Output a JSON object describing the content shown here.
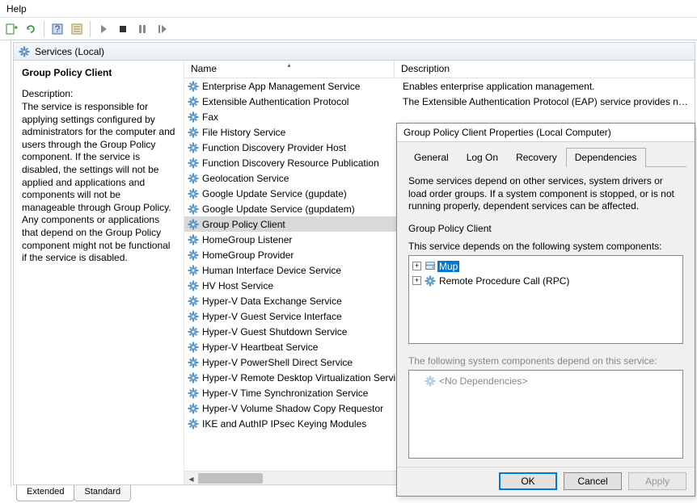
{
  "menu": {
    "help": "Help"
  },
  "header": {
    "title": "Services (Local)"
  },
  "desc_pane": {
    "title": "Group Policy Client",
    "label": "Description:",
    "text": "The service is responsible for applying settings configured by administrators for the computer and users through the Group Policy component. If the service is disabled, the settings will not be applied and applications and components will not be manageable through Group Policy. Any components or applications that depend on the Group Policy component might not be functional if the service is disabled."
  },
  "columns": {
    "name": "Name",
    "description": "Description"
  },
  "services": [
    {
      "name": "Enterprise App Management Service",
      "desc": "Enables enterprise application management."
    },
    {
      "name": "Extensible Authentication Protocol",
      "desc": "The Extensible Authentication Protocol (EAP) service provides n…"
    },
    {
      "name": "Fax",
      "desc": ""
    },
    {
      "name": "File History Service",
      "desc": ""
    },
    {
      "name": "Function Discovery Provider Host",
      "desc": ""
    },
    {
      "name": "Function Discovery Resource Publication",
      "desc": ""
    },
    {
      "name": "Geolocation Service",
      "desc": ""
    },
    {
      "name": "Google Update Service (gupdate)",
      "desc": ""
    },
    {
      "name": "Google Update Service (gupdatem)",
      "desc": ""
    },
    {
      "name": "Group Policy Client",
      "desc": "",
      "selected": true
    },
    {
      "name": "HomeGroup Listener",
      "desc": ""
    },
    {
      "name": "HomeGroup Provider",
      "desc": ""
    },
    {
      "name": "Human Interface Device Service",
      "desc": ""
    },
    {
      "name": "HV Host Service",
      "desc": ""
    },
    {
      "name": "Hyper-V Data Exchange Service",
      "desc": ""
    },
    {
      "name": "Hyper-V Guest Service Interface",
      "desc": ""
    },
    {
      "name": "Hyper-V Guest Shutdown Service",
      "desc": ""
    },
    {
      "name": "Hyper-V Heartbeat Service",
      "desc": ""
    },
    {
      "name": "Hyper-V PowerShell Direct Service",
      "desc": ""
    },
    {
      "name": "Hyper-V Remote Desktop Virtualization Servi",
      "desc": ""
    },
    {
      "name": "Hyper-V Time Synchronization Service",
      "desc": ""
    },
    {
      "name": "Hyper-V Volume Shadow Copy Requestor",
      "desc": ""
    },
    {
      "name": "IKE and AuthIP IPsec Keying Modules",
      "desc": ""
    }
  ],
  "bottom_tabs": {
    "extended": "Extended",
    "standard": "Standard"
  },
  "dialog": {
    "title": "Group Policy Client Properties (Local Computer)",
    "tabs": {
      "general": "General",
      "logon": "Log On",
      "recovery": "Recovery",
      "dependencies": "Dependencies"
    },
    "info": "Some services depend on other services, system drivers or load order groups. If a system component is stopped, or is not running properly, dependent services can be affected.",
    "service_name": "Group Policy Client",
    "depends_label": "This service depends on the following system components:",
    "deps": [
      {
        "name": "Mup",
        "selected": true,
        "icon": "drive"
      },
      {
        "name": "Remote Procedure Call (RPC)",
        "selected": false,
        "icon": "gear"
      }
    ],
    "depended_label": "The following system components depend on this service:",
    "no_deps": "<No Dependencies>",
    "buttons": {
      "ok": "OK",
      "cancel": "Cancel",
      "apply": "Apply"
    }
  }
}
